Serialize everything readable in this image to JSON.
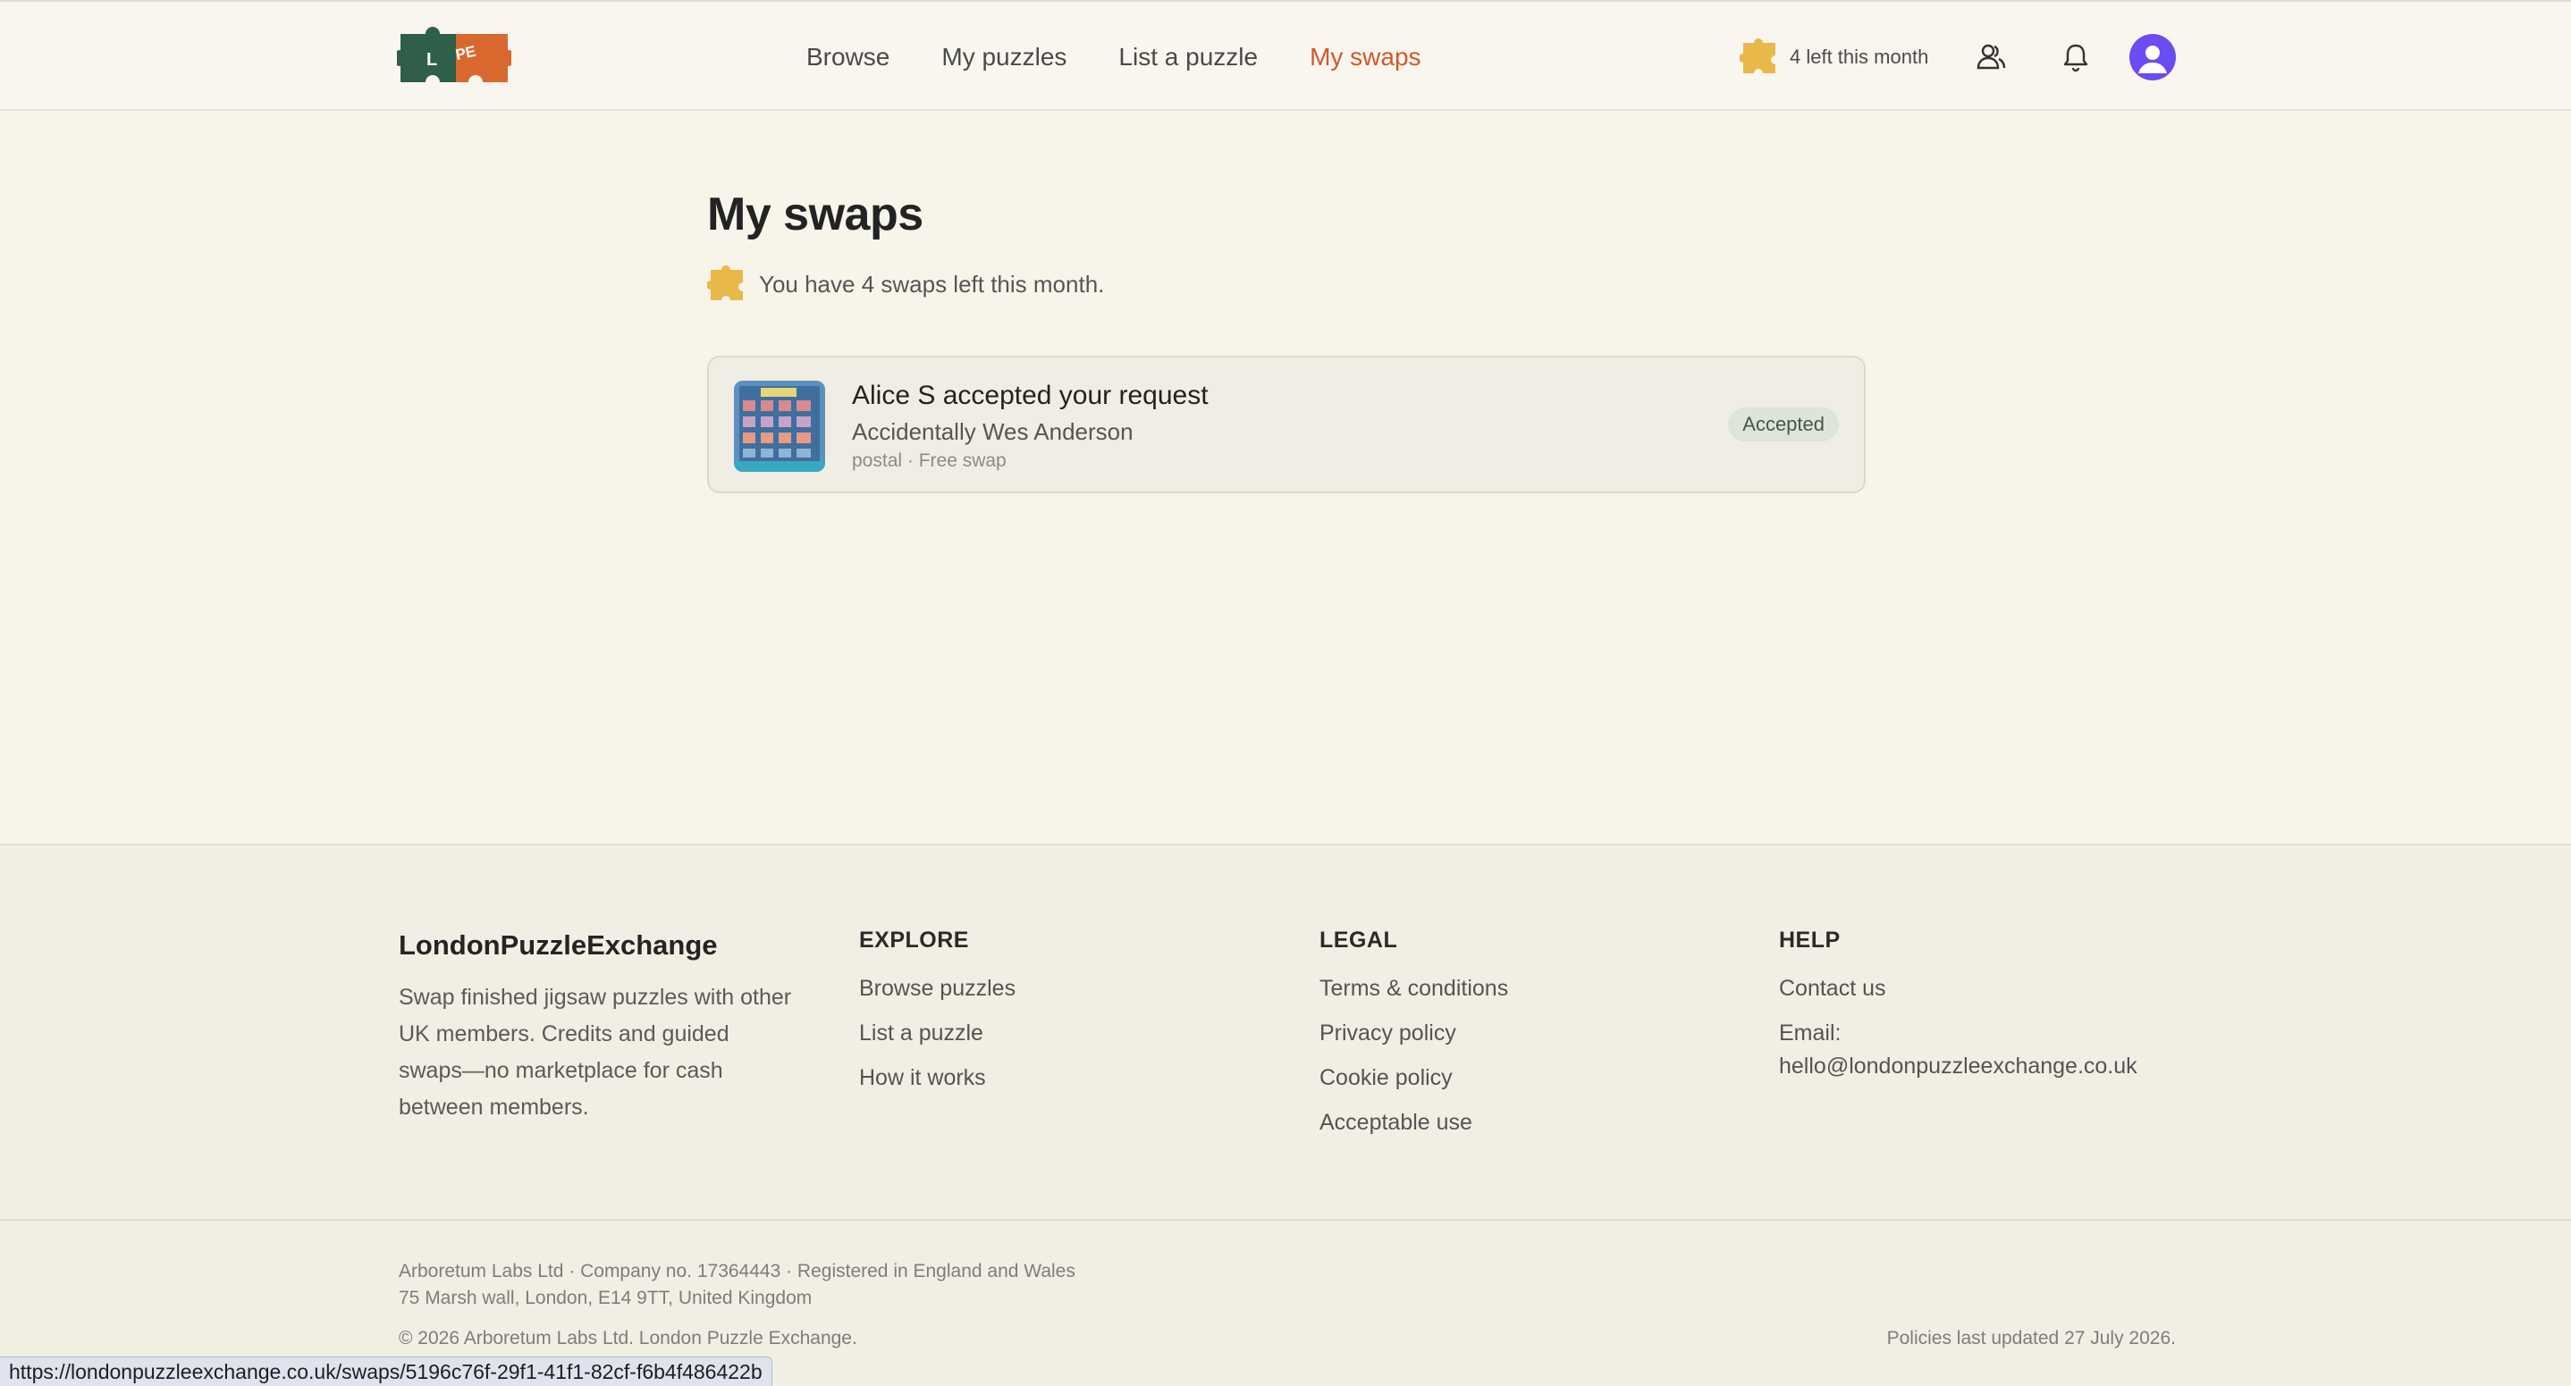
{
  "header": {
    "logo_letters": "L PE",
    "nav": [
      {
        "label": "Browse",
        "active": false
      },
      {
        "label": "My puzzles",
        "active": false
      },
      {
        "label": "List a puzzle",
        "active": false
      },
      {
        "label": "My swaps",
        "active": true
      }
    ],
    "credits_text": "4 left this month",
    "icons": [
      "puzzle-piece-icon",
      "people-icon",
      "bell-icon",
      "avatar-icon"
    ],
    "accent_color": "#d4572a",
    "credit_color": "#e8b84a"
  },
  "main": {
    "title": "My swaps",
    "remaining_text": "You have 4 swaps left this month.",
    "swaps": [
      {
        "title": "Alice S accepted your request",
        "puzzle": "Accidentally Wes Anderson",
        "meta": "postal · Free swap",
        "status": "Accepted"
      }
    ]
  },
  "footer": {
    "brand": "LondonPuzzleExchange",
    "description": "Swap finished jigsaw puzzles with other UK members. Credits and guided swaps—no marketplace for cash between members.",
    "explore": {
      "heading": "EXPLORE",
      "links": [
        "Browse puzzles",
        "List a puzzle",
        "How it works"
      ]
    },
    "legal": {
      "heading": "LEGAL",
      "links": [
        "Terms & conditions",
        "Privacy policy",
        "Cookie policy",
        "Acceptable use"
      ]
    },
    "help": {
      "heading": "HELP",
      "contact": "Contact us",
      "email_label": "Email:",
      "email": "hello@londonpuzzleexchange.co.uk"
    },
    "company_line1": "Arboretum Labs Ltd · Company no. 17364443 · Registered in England and Wales",
    "company_line2": "75 Marsh wall, London, E14 9TT, United Kingdom",
    "copyright": "© 2026 Arboretum Labs Ltd. London Puzzle Exchange.",
    "policies_updated": "Policies last updated 27 July 2026."
  },
  "status_url": "https://londonpuzzleexchange.co.uk/swaps/5196c76f-29f1-41f1-82cf-f6b4f486422b"
}
